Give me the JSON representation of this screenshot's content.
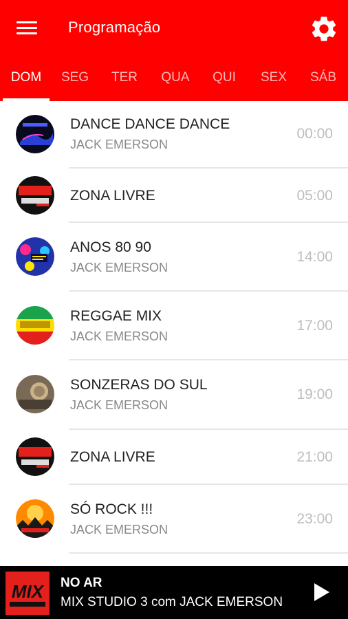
{
  "header": {
    "title": "Programação",
    "menu_icon": "hamburger-menu-icon",
    "settings_icon": "gear-icon",
    "bg_color": "#ff0000"
  },
  "tabs": [
    {
      "label": "DOM",
      "active": true
    },
    {
      "label": "SEG"
    },
    {
      "label": "TER"
    },
    {
      "label": "QUA"
    },
    {
      "label": "QUI"
    },
    {
      "label": "SEX"
    },
    {
      "label": "SÁB"
    }
  ],
  "schedule": [
    {
      "title": "DANCE DANCE DANCE",
      "host": "JACK EMERSON",
      "time": "00:00"
    },
    {
      "title": "ZONA LIVRE",
      "host": "",
      "time": "05:00"
    },
    {
      "title": "ANOS 80 90",
      "host": "JACK EMERSON",
      "time": "14:00"
    },
    {
      "title": "REGGAE MIX",
      "host": "JACK EMERSON",
      "time": "17:00"
    },
    {
      "title": "SONZERAS DO SUL",
      "host": "JACK EMERSON",
      "time": "19:00"
    },
    {
      "title": "ZONA LIVRE",
      "host": "",
      "time": "21:00"
    },
    {
      "title": "SÓ ROCK !!!",
      "host": "JACK EMERSON",
      "time": "23:00"
    }
  ],
  "player": {
    "label": "NO AR",
    "now_playing": "MIX STUDIO 3 com JACK EMERSON",
    "logo_text": "MIX",
    "play_icon": "play-icon"
  }
}
